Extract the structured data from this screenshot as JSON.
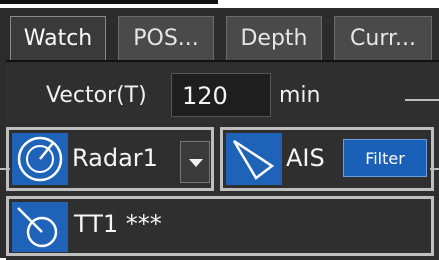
{
  "tabs": [
    {
      "label": "Watch"
    },
    {
      "label": "POS..."
    },
    {
      "label": "Depth"
    },
    {
      "label": "Curr..."
    }
  ],
  "vector": {
    "label": "Vector(T)",
    "value": "120",
    "unit": "min"
  },
  "radar": {
    "label": "Radar1",
    "icon": "radar-icon"
  },
  "ais": {
    "label": "AIS",
    "icon": "ais-target-icon",
    "filter_label": "Filter"
  },
  "tt": {
    "label": "TT1 ***",
    "icon": "tracked-target-icon"
  },
  "colors": {
    "accent_blue": "#1f63b8",
    "panel_bg": "#2c2c2c",
    "frame": "#bfbfbf"
  }
}
